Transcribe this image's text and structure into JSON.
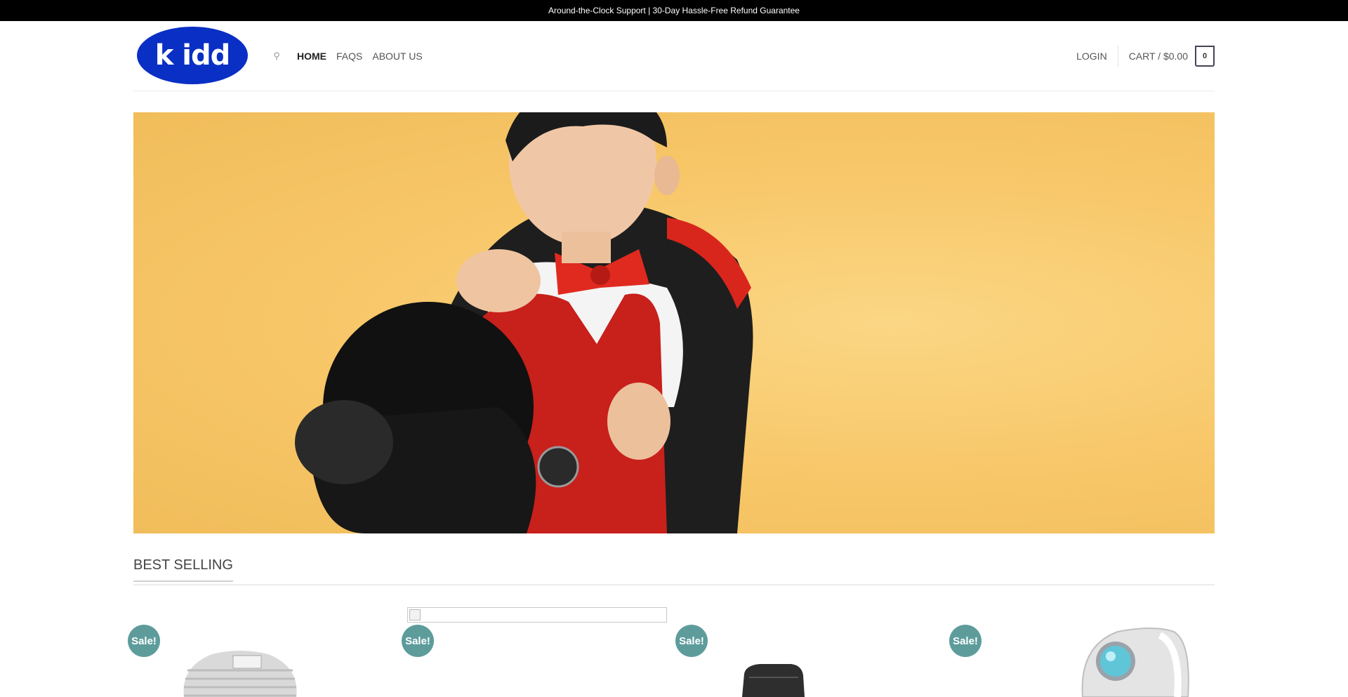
{
  "topbar": {
    "text": "Around-the-Clock Support | 30-Day Hassle-Free Refund Guarantee"
  },
  "header": {
    "logo_text": "k idd",
    "nav": [
      {
        "label": "HOME",
        "active": true
      },
      {
        "label": "FAQS",
        "active": false
      },
      {
        "label": "ABOUT US",
        "active": false
      }
    ],
    "login_label": "LOGIN",
    "cart_label": "CART / $0.00",
    "cart_count": "0"
  },
  "hero": {
    "alt": "Child in magician costume with top hat"
  },
  "section": {
    "title": "BEST SELLING"
  },
  "products": [
    {
      "badge": "Sale!",
      "icon": "striped-onesie-icon"
    },
    {
      "badge": "Sale!",
      "icon": "broken-image-icon"
    },
    {
      "badge": "Sale!",
      "icon": "chair-icon"
    },
    {
      "badge": "Sale!",
      "icon": "ring-icon"
    }
  ],
  "colors": {
    "topbar_bg": "#000000",
    "logo_bg": "#0a2fc4",
    "sale_badge": "#5e9c9c",
    "hero_bg": "#f7c667"
  }
}
